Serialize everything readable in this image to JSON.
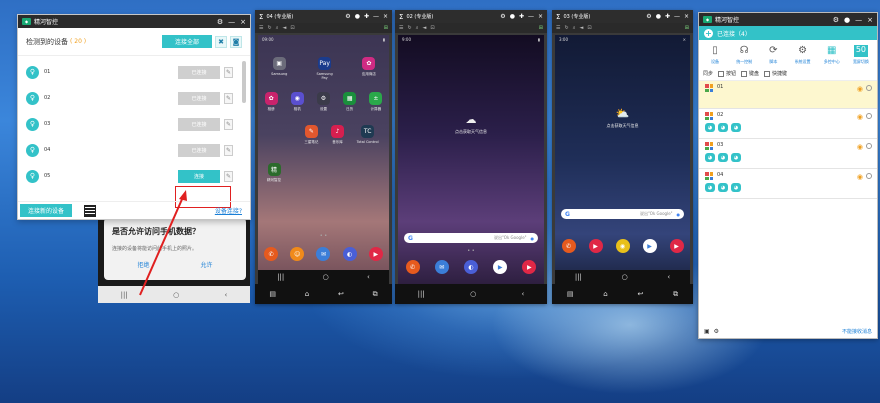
{
  "detect": {
    "app_title": "精河智控",
    "heading": "检测到的设备",
    "count": "( 20 )",
    "select_all": "连接全部",
    "devices": [
      {
        "name": "01",
        "button": "已连接"
      },
      {
        "name": "02",
        "button": "已连接"
      },
      {
        "name": "03",
        "button": "已连接"
      },
      {
        "name": "04",
        "button": "已连接"
      },
      {
        "name": "05",
        "button": "连接"
      }
    ],
    "new_device": "连接新的设备",
    "help": "设备连接?"
  },
  "bg_phone": {
    "question": "是否允许访问手机数据？",
    "desc": "连接的设备将能访问此手机上的照片。",
    "deny": "拒绝",
    "allow": "允许"
  },
  "phones": [
    {
      "title": "04 (专业版)",
      "time": "09:00",
      "apps_top": [
        {
          "label": "Samsung",
          "color": "#6b6b7a",
          "glyph": "▣"
        },
        {
          "label": "Samsung Pay",
          "color": "#1a3b8c",
          "glyph": "Pay"
        },
        {
          "label": "应用商店",
          "color": "#d02b83",
          "glyph": "✿"
        }
      ],
      "apps_mid": [
        {
          "label": "相册",
          "color": "#c9236c",
          "glyph": "✿"
        },
        {
          "label": "相机",
          "color": "#5a4fcf",
          "glyph": "◉"
        },
        {
          "label": "设置",
          "color": "#3b3b4a",
          "glyph": "⚙"
        },
        {
          "label": "日历",
          "color": "#1a8f3c",
          "glyph": "▦"
        },
        {
          "label": "计算器",
          "color": "#2aa84a",
          "glyph": "±"
        }
      ],
      "apps_row3": [
        {
          "label": "三星笔记",
          "color": "#e2572e",
          "glyph": "✎"
        },
        {
          "label": "音乐库",
          "color": "#d61f4f",
          "glyph": "♪"
        },
        {
          "label": "Total Control",
          "color": "#1f3a52",
          "glyph": "TC"
        }
      ],
      "apps_row4": [
        {
          "label": "精河智控",
          "color": "#2b6b2b",
          "glyph": "精"
        }
      ],
      "dock": [
        {
          "label": "phone",
          "color": "#e65a1e",
          "glyph": "✆"
        },
        {
          "label": "contacts",
          "color": "#f08a1a",
          "glyph": "☺"
        },
        {
          "label": "messages",
          "color": "#3b7ed8",
          "glyph": "✉"
        },
        {
          "label": "browser",
          "color": "#4a5fd6",
          "glyph": "◐"
        },
        {
          "label": "video",
          "color": "#e02846",
          "glyph": "▶"
        }
      ]
    },
    {
      "title": "02 (专业版)",
      "time": "9:00",
      "weather_text": "点击获取天气信息",
      "search_hint": "说出\"Ok Google\"",
      "dock": [
        {
          "label": "phone",
          "color": "#e65a1e",
          "glyph": "✆"
        },
        {
          "label": "messages",
          "color": "#3b7ed8",
          "glyph": "✉"
        },
        {
          "label": "browser",
          "color": "#4a5fd6",
          "glyph": "◐"
        },
        {
          "label": "play",
          "color": "#ffffff",
          "glyph": "▶"
        },
        {
          "label": "video",
          "color": "#e02846",
          "glyph": "▶"
        }
      ]
    },
    {
      "title": "03 (专业版)",
      "time": "3:00",
      "weather_text": "点击获取天气信息",
      "search_hint": "说出\"Ok Google\"",
      "dock": [
        {
          "label": "phone",
          "color": "#e65a1e",
          "glyph": "✆"
        },
        {
          "label": "video",
          "color": "#e02846",
          "glyph": "▶"
        },
        {
          "label": "chrome",
          "color": "#e8c01a",
          "glyph": "◉"
        },
        {
          "label": "play",
          "color": "#ffffff",
          "glyph": "▶"
        },
        {
          "label": "youtube",
          "color": "#e02846",
          "glyph": "▶"
        }
      ]
    }
  ],
  "panel": {
    "app_title": "精河智控",
    "connected": "已连接（4）",
    "tools": [
      {
        "label": "设备",
        "glyph": "▯"
      },
      {
        "label": "统一控制",
        "glyph": "☊"
      },
      {
        "label": "脚本",
        "glyph": "⟳"
      },
      {
        "label": "系统设置",
        "glyph": "⚙"
      },
      {
        "label": "多控中心",
        "glyph": "▦"
      },
      {
        "label": "宽屏切换",
        "glyph": "50"
      }
    ],
    "sync_label": "同步",
    "sync_opts": [
      "按钮",
      "键盘",
      "快捷键"
    ],
    "rows": [
      {
        "name": "01"
      },
      {
        "name": "02"
      },
      {
        "name": "03"
      },
      {
        "name": "04"
      }
    ],
    "footer_link": "不能接收消息"
  }
}
